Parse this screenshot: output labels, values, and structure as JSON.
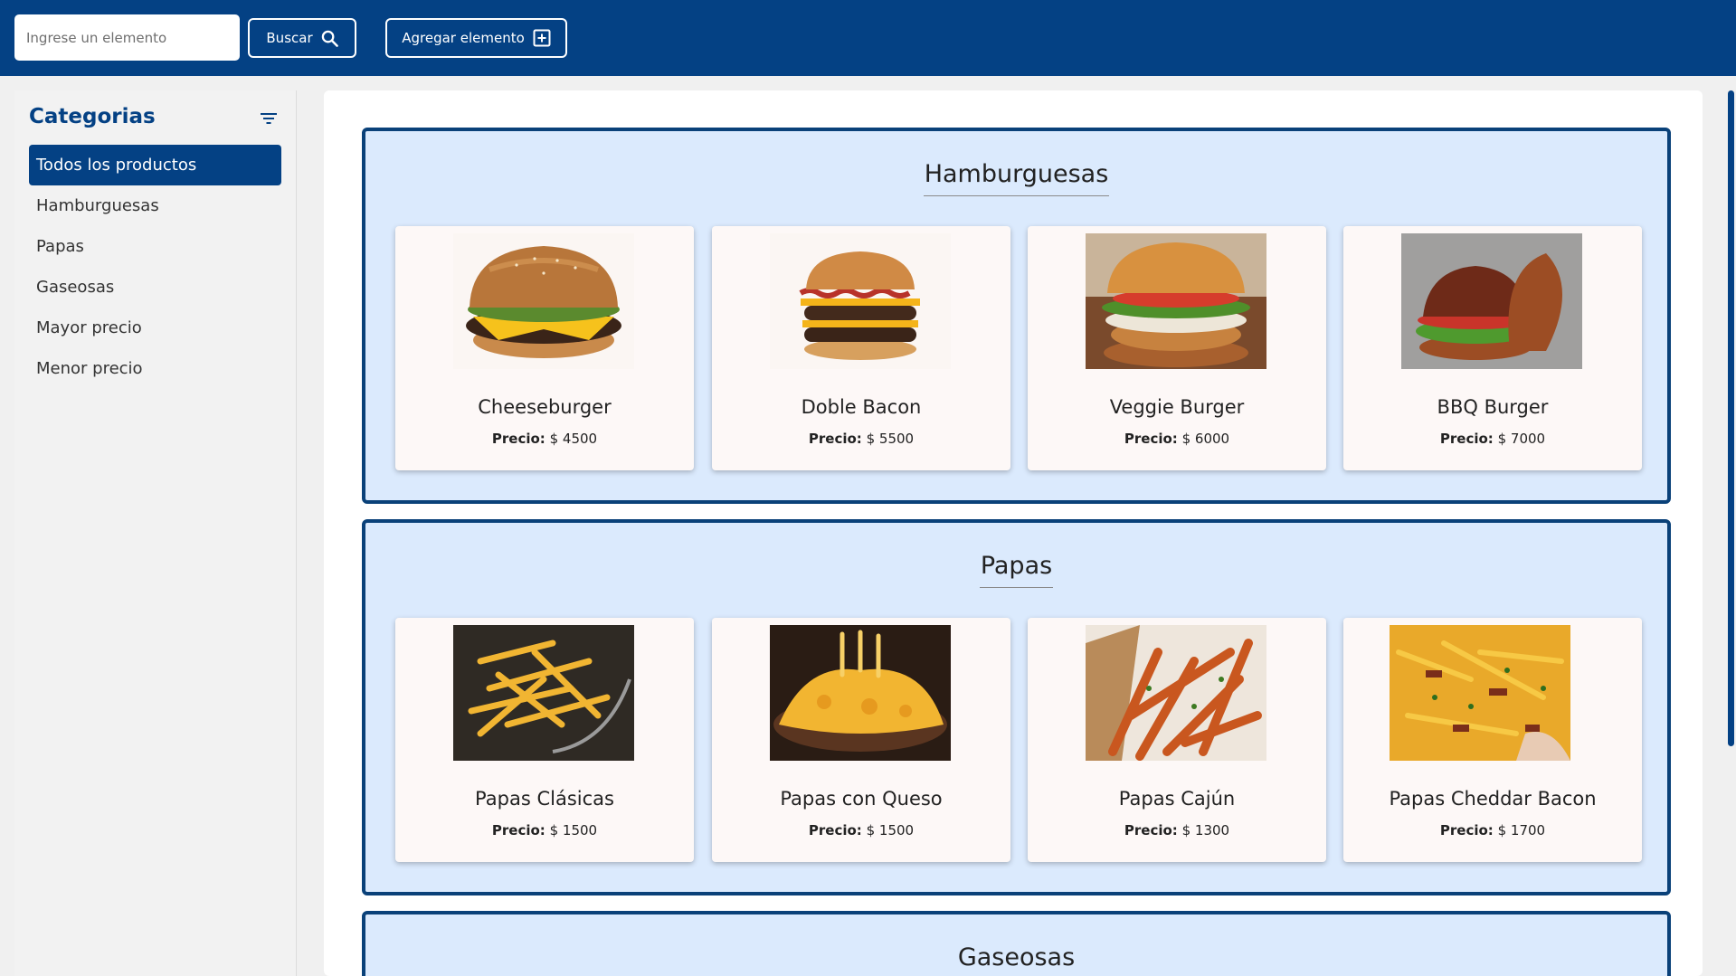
{
  "header": {
    "search_placeholder": "Ingrese un elemento",
    "search_button": "Buscar",
    "add_button": "Agregar elemento"
  },
  "sidebar": {
    "title": "Categorias",
    "items": [
      {
        "label": "Todos los productos",
        "active": true
      },
      {
        "label": "Hamburguesas"
      },
      {
        "label": "Papas"
      },
      {
        "label": "Gaseosas"
      },
      {
        "label": "Mayor precio"
      },
      {
        "label": "Menor precio"
      }
    ]
  },
  "price_label": "Precio:",
  "sections": [
    {
      "title": "Hamburguesas",
      "products": [
        {
          "name": "Cheeseburger",
          "price": "$ 4500"
        },
        {
          "name": "Doble Bacon",
          "price": "$ 5500"
        },
        {
          "name": "Veggie Burger",
          "price": "$ 6000"
        },
        {
          "name": "BBQ Burger",
          "price": "$ 7000"
        }
      ]
    },
    {
      "title": "Papas",
      "products": [
        {
          "name": "Papas Clásicas",
          "price": "$ 1500"
        },
        {
          "name": "Papas con Queso",
          "price": "$ 1500"
        },
        {
          "name": "Papas Cajún",
          "price": "$ 1300"
        },
        {
          "name": "Papas Cheddar Bacon",
          "price": "$ 1700"
        }
      ]
    },
    {
      "title": "Gaseosas"
    }
  ],
  "colors": {
    "primary": "#044184",
    "section_bg": "#dbeafd",
    "section_border": "#0a4179",
    "card_bg": "#fdf8f7"
  },
  "icons": {
    "search": "search-icon",
    "add": "plus-square-icon",
    "filter": "filter-icon"
  }
}
